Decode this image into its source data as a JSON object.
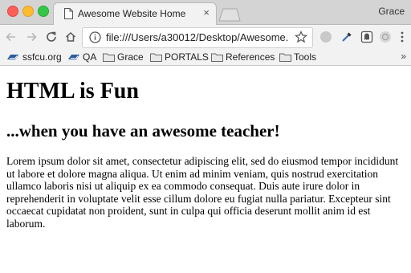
{
  "tabs": [
    {
      "title": "Awesome Website Home",
      "icon": "document-icon",
      "close": "×"
    }
  ],
  "profile": {
    "name": "Grace"
  },
  "toolbar": {
    "url": "file:///Users/a30012/Desktop/Awesome...",
    "icons": [
      "back-icon",
      "forward-icon",
      "reload-icon",
      "home-icon",
      "info-icon",
      "star-icon",
      "extension-icon",
      "eyedropper-icon",
      "ghostery-icon",
      "extension-icon",
      "menu-icon"
    ]
  },
  "bookmarks": {
    "items": [
      {
        "label": "ssfcu.org",
        "icon": "ssfcu-icon"
      },
      {
        "label": "QA",
        "icon": "ssfcu-icon"
      },
      {
        "label": "Grace",
        "icon": "folder-icon"
      },
      {
        "label": "PORTALS",
        "icon": "folder-icon"
      },
      {
        "label": "References",
        "icon": "folder-icon"
      },
      {
        "label": "Tools",
        "icon": "folder-icon"
      }
    ],
    "more": "»"
  },
  "page": {
    "heading": "HTML is Fun",
    "subheading": "...when you have an awesome teacher!",
    "paragraph": "Lorem ipsum dolor sit amet, consectetur adipiscing elit, sed do eiusmod tempor incididunt ut labore et dolore magna aliqua. Ut enim ad minim veniam, quis nostrud exercitation ullamco laboris nisi ut aliquip ex ea commodo consequat. Duis aute irure dolor in reprehenderit in voluptate velit esse cillum dolore eu fugiat nulla pariatur. Excepteur sint occaecat cupidatat non proident, sunt in culpa qui officia deserunt mollit anim id est laborum."
  },
  "colors": {
    "close": "#fc5f57",
    "minimize": "#fdbc2e",
    "maximize": "#33c748",
    "chrome_bg": "#f2f2f2",
    "bookmark_icon": "#2b5c9c"
  }
}
